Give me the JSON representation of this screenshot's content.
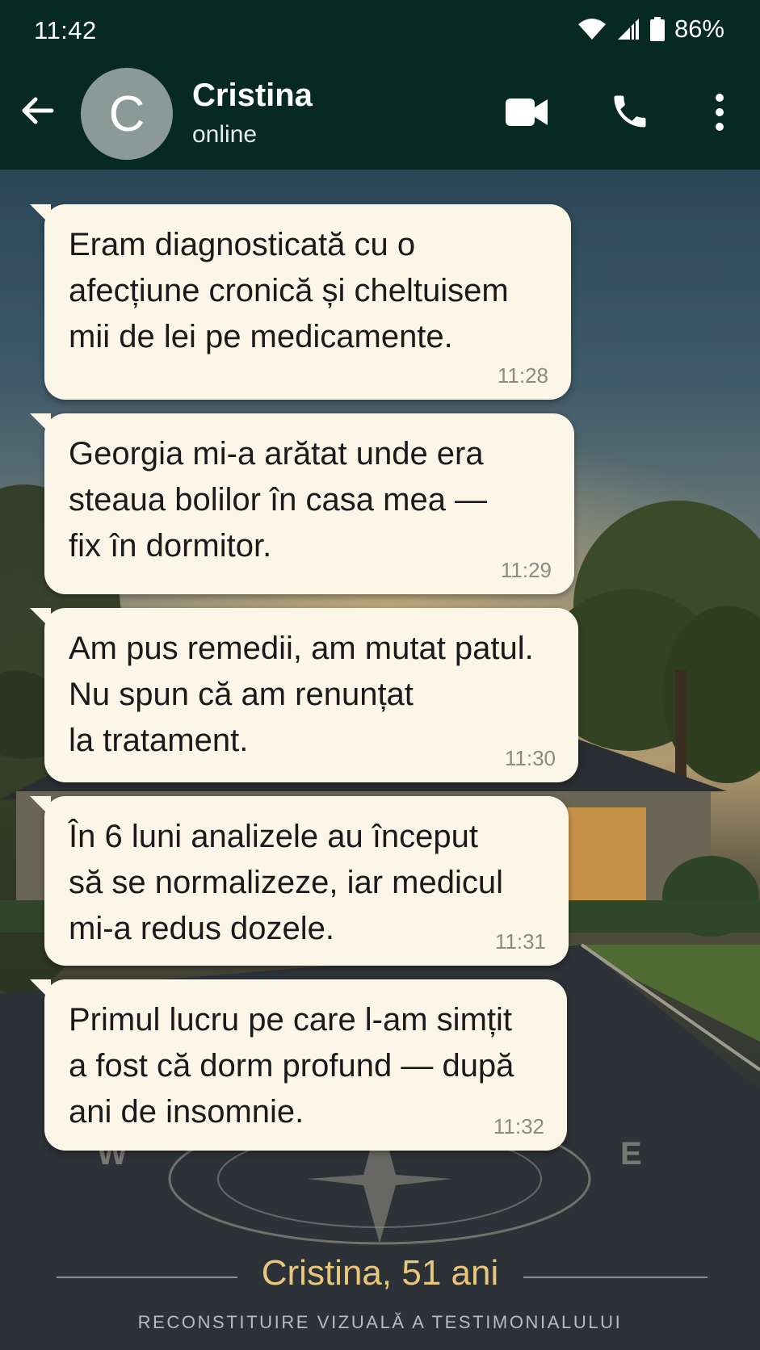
{
  "status_bar": {
    "time": "11:42",
    "battery": "86%"
  },
  "header": {
    "avatar_letter": "C",
    "contact_name": "Cristina",
    "contact_status": "online"
  },
  "messages": [
    {
      "text": "Eram diagnosticată cu o\nafecțiune cronică și cheltuisem\nmii de lei pe medicamente.",
      "time": "11:28"
    },
    {
      "text": "Georgia mi-a arătat unde era\nsteaua bolilor în casa mea —\nfix în dormitor.",
      "time": "11:29"
    },
    {
      "text": "Am pus remedii, am mutat patul.\nNu spun că am renunțat\nla tratament.",
      "time": "11:30"
    },
    {
      "text": "În 6 luni analizele au început\nsă se normalizeze, iar medicul\nmi-a redus dozele.",
      "time": "11:31"
    },
    {
      "text": "Primul lucru pe care l-am simțit\na fost că dorm profund — după\nani de insomnie.",
      "time": "11:32"
    }
  ],
  "background": {
    "compass_letters": [
      "W",
      "E"
    ]
  },
  "footer": {
    "name": "Cristina, 51 ani",
    "caption": "RECONSTITUIRE VIZUALĂ A TESTIMONIALULUI"
  },
  "icons": [
    "back-arrow-icon",
    "video-call-icon",
    "phone-call-icon",
    "more-menu-icon",
    "wifi-icon",
    "signal-icon",
    "battery-icon"
  ]
}
